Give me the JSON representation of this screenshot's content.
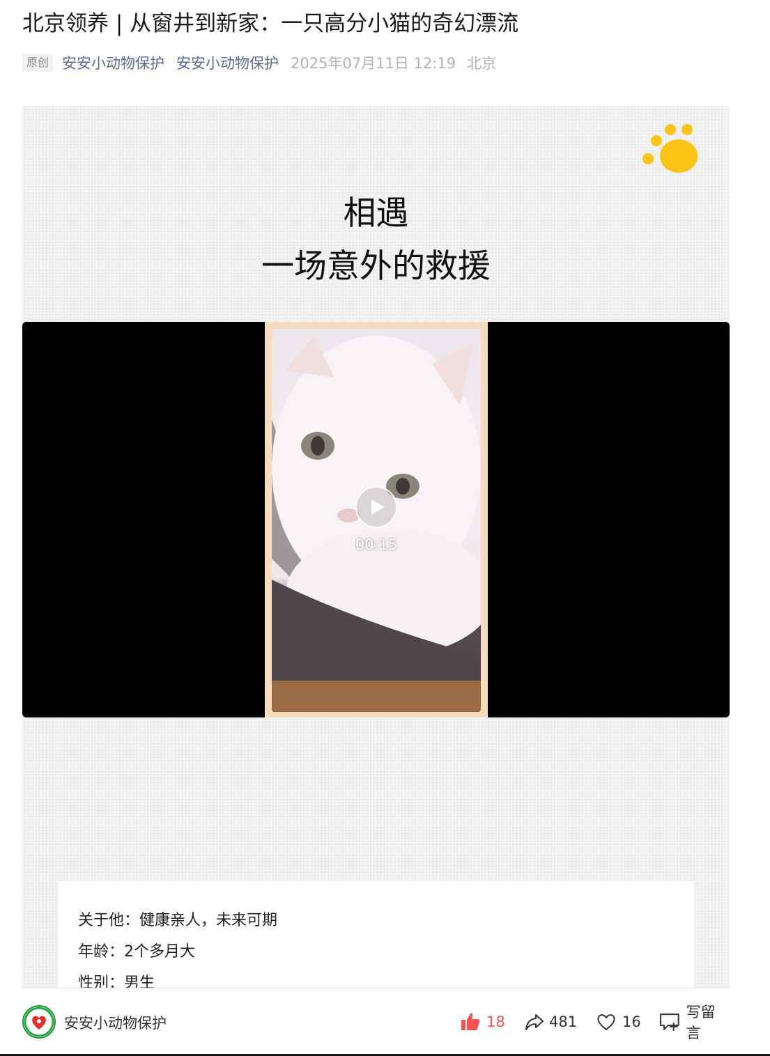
{
  "article": {
    "title": "北京领养 | 从窗井到新家：一只高分小猫的奇幻漂流",
    "original_tag": "原创",
    "author": "安安小动物保护",
    "account": "安安小动物保护",
    "date": "2025年07月11日 12:19",
    "location": "北京"
  },
  "card": {
    "heading_line1": "相遇",
    "heading_line2": "一场意外的救援",
    "paw_icon_color": "#fcc414",
    "video": {
      "duration": "00:15"
    },
    "info": {
      "line1": "关于他：健康亲人，未来可期",
      "line2": "年龄：2个多月大",
      "line3": "性别：男生"
    }
  },
  "footer": {
    "account_name": "安安小动物保护",
    "like_count": "18",
    "share_count": "481",
    "favorite_count": "16",
    "comment_label": "写留言",
    "like_color": "#fa5151"
  }
}
